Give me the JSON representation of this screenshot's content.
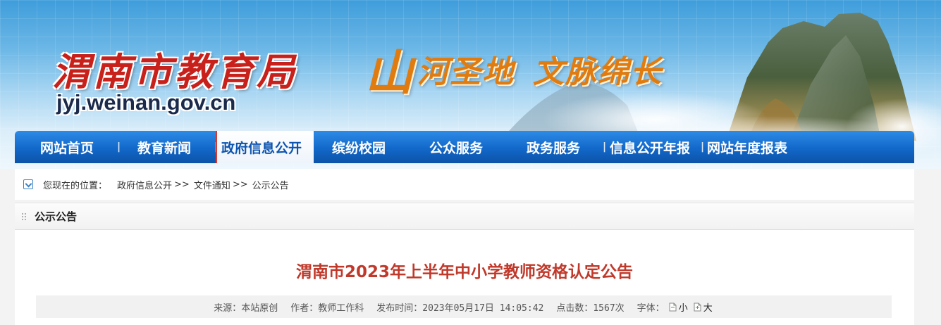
{
  "site": {
    "logo_title": "渭南市教育局",
    "logo_url": "jyj.weinan.gov.cn",
    "slogan_big": "山",
    "slogan_rest1": "河圣地",
    "slogan_rest2": "文脉绵长"
  },
  "nav": {
    "items": [
      {
        "label": "网站首页"
      },
      {
        "label": "教育新闻"
      },
      {
        "label": "政府信息公开",
        "active": true
      },
      {
        "label": "缤纷校园"
      },
      {
        "label": "公众服务"
      },
      {
        "label": "政务服务"
      },
      {
        "label": "信息公开年报"
      },
      {
        "label": "网站年度报表"
      }
    ]
  },
  "breadcrumb": {
    "lead": "您现在的位置：",
    "items": [
      "政府信息公开",
      "文件通知",
      "公示公告"
    ],
    "sep": ">>"
  },
  "section": {
    "title": "公示公告"
  },
  "article": {
    "title": "渭南市2023年上半年中小学教师资格认定公告",
    "source": "来源：本站原创",
    "author": "作者：教师工作科",
    "published": "发布时间：2023年05月17日 14:05:42",
    "hits": "点击数：1567次",
    "font_label": "字体：",
    "font_small": "小",
    "font_large": "大"
  },
  "colors": {
    "nav_blue": "#1268c9",
    "title_red": "#c0392b",
    "logo_red": "#c8201a",
    "slogan_orange": "#e07b10"
  }
}
